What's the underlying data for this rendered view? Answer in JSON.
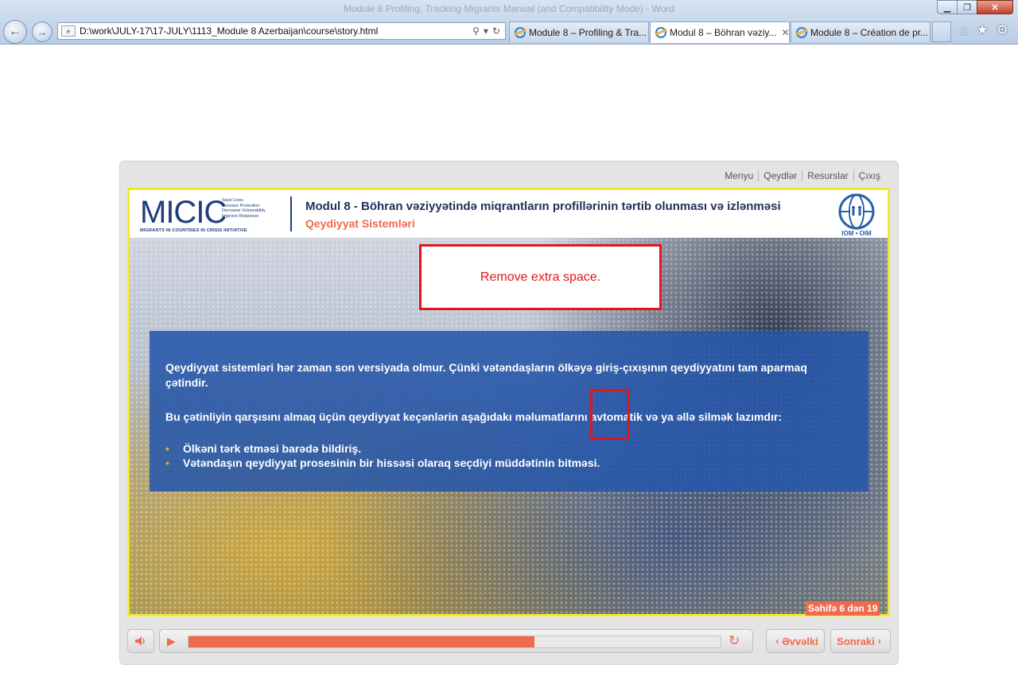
{
  "browser": {
    "window_title": "Module 8 Profiling, Tracking Migrants Manual (and Compatibility Mode) - Word",
    "address": "D:\\work\\JULY-17\\17-JULY\\1113_Module 8 Azerbaijan\\course\\story.html",
    "tabs": [
      {
        "label": "Module 8 – Profiling & Tra..."
      },
      {
        "label": "Modul 8 – Böhran vəziy..."
      },
      {
        "label": "Module 8 – Création de pr..."
      }
    ]
  },
  "player": {
    "menu": [
      "Menyu",
      "Qeydlər",
      "Resurslar",
      "Çıxış"
    ],
    "header": {
      "logo_word": "MICIC",
      "logo_tagline": [
        "Save Lives",
        "Increase Protection",
        "Decrease Vulnerability",
        "Improve Response"
      ],
      "logo_subtitle": "MIGRANTS IN COUNTRIES IN CRISIS INITIATIVE",
      "title": "Modul 8 - Böhran vəziyyətində miqrantların profillərinin tərtib olunması və izlənməsi",
      "subtitle": "Qeydiyyat Sistemləri",
      "iom_label": "IOM • OIM"
    },
    "annotation": "Remove extra space.",
    "content": {
      "paragraph1": "Qeydiyyat sistemləri hər zaman son versiyada olmur. Çünki vətəndaşların ölkəyə giriş-çıxışının qeydiyyatını tam aparmaq çətindir.",
      "paragraph2": "Bu çətinliyin qarşısını almaq üçün qeydiyyat keçənlərin aşağıdakı məlumatlarını  avtomatik və ya əllə silmək lazımdır:",
      "bullets": [
        "Ölkəni tərk etməsi barədə bildiriş.",
        "Vətəndaşın qeydiyyat prosesinin bir hissəsi olaraq seçdiyi müddətinin bitməsi."
      ],
      "bullet_glyph": "•"
    },
    "page_counter": "Səhifə 6 dən 19",
    "controls": {
      "progress_fraction": 0.65,
      "prev_label": "Əvvəlki",
      "next_label": "Sonraki"
    },
    "colors": {
      "accent": "#f06a50",
      "frame": "#f2ea2a",
      "panel": "#2656aa",
      "annotation": "#e2141c"
    }
  }
}
